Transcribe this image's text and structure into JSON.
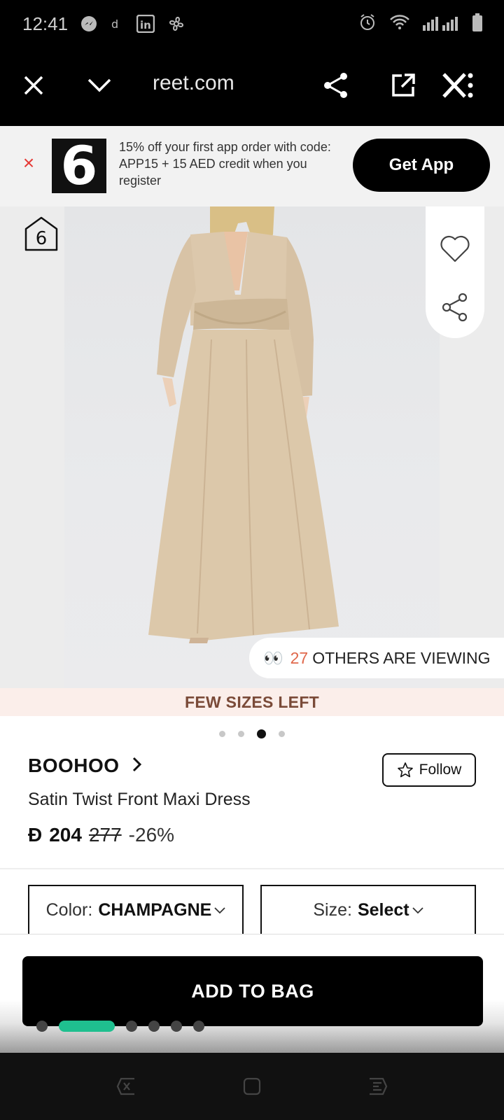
{
  "status_bar": {
    "time": "12:41"
  },
  "browser": {
    "url": "reet.com"
  },
  "banner": {
    "close": "×",
    "logo": "6",
    "text": "15% off your first app order with code: APP15 + 15 AED credit when you register",
    "button": "Get App"
  },
  "gallery": {
    "badge": "6",
    "viewing_icon": "👀",
    "viewing_count": "27",
    "viewing_text": "OTHERS ARE VIEWING",
    "few_sizes": "FEW SIZES LEFT",
    "image_index": 3,
    "image_count": 4
  },
  "product": {
    "brand": "BOOHOO",
    "brand_chevron": "›",
    "follow_label": "Follow",
    "title": "Satin Twist Front Maxi Dress",
    "currency": "Đ",
    "price": "204",
    "price_was": "277",
    "discount": "-26%"
  },
  "options": {
    "color_label": "Color:",
    "color_value": "CHAMPAGNE",
    "size_label": "Size:",
    "size_value": "Select"
  },
  "cta": {
    "add_to_bag": "ADD TO BAG"
  },
  "colors": {
    "accent_green": "#1fbf8f",
    "viewing_count": "#e0684b",
    "close_red": "#e53935"
  }
}
